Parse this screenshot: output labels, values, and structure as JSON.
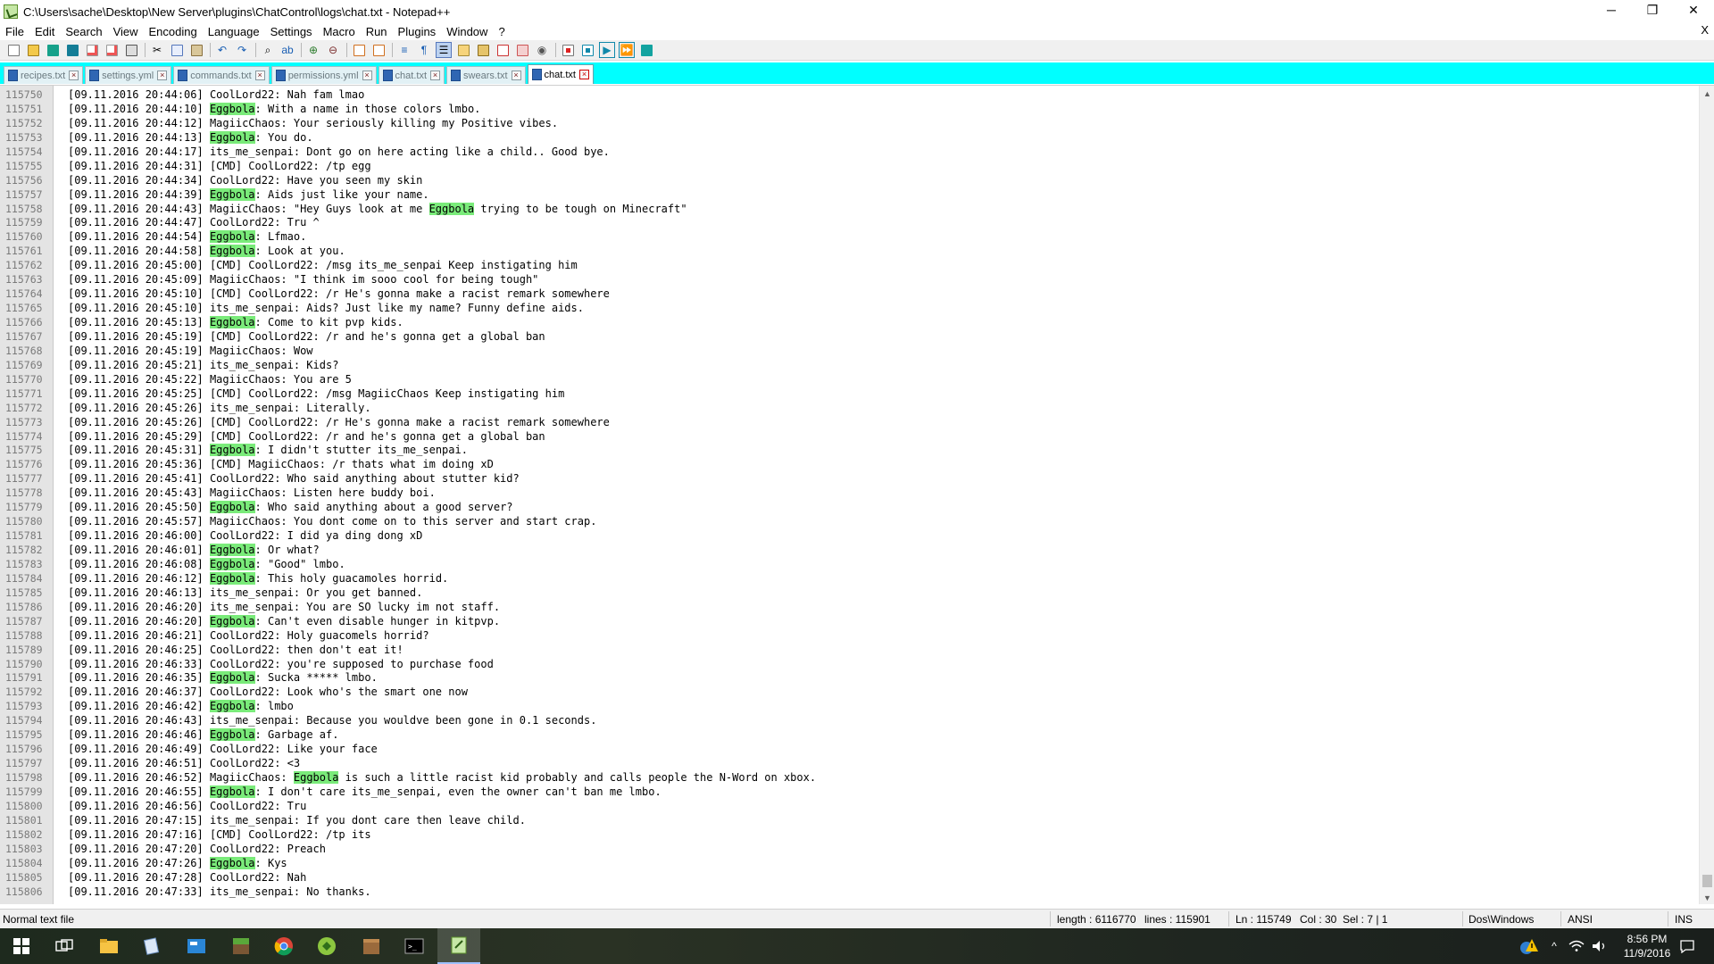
{
  "window": {
    "title": "C:\\Users\\sache\\Desktop\\New Server\\plugins\\ChatControl\\logs\\chat.txt - Notepad++",
    "controls": {
      "minimize": "─",
      "restore": "❐",
      "close": "✕"
    }
  },
  "menu": {
    "items": [
      "File",
      "Edit",
      "Search",
      "View",
      "Encoding",
      "Language",
      "Settings",
      "Macro",
      "Run",
      "Plugins",
      "Window",
      "?"
    ],
    "close_glyph": "X"
  },
  "toolbar": {
    "buttons": [
      "new-file",
      "open-file",
      "save",
      "save-all",
      "close",
      "close-all",
      "print",
      "cut",
      "copy",
      "paste",
      "undo",
      "redo",
      "find",
      "replace",
      "zoom-in",
      "zoom-out",
      "sync-vertical",
      "sync-horizontal",
      "word-wrap",
      "show-all-chars",
      "indent-guide",
      "user-defined-language",
      "document-map",
      "function-list",
      "folder-as-workspace",
      "monitoring",
      "macro-record",
      "macro-stop",
      "macro-play",
      "macro-play-multiple",
      "macro-save"
    ]
  },
  "tabs": [
    {
      "label": "recipes.txt",
      "active": false
    },
    {
      "label": "settings.yml",
      "active": false
    },
    {
      "label": "commands.txt",
      "active": false
    },
    {
      "label": "permissions.yml",
      "active": false
    },
    {
      "label": "chat.txt",
      "active": false
    },
    {
      "label": "swears.txt",
      "active": false
    },
    {
      "label": "chat.txt",
      "active": true
    }
  ],
  "editor": {
    "highlight_word": "Eggbola",
    "highlight_color": "#7aeb7a",
    "lines": [
      {
        "n": "115750",
        "text": "[09.11.2016 20:44:06] CoolLord22: Nah fam lmao"
      },
      {
        "n": "115751",
        "text": "[09.11.2016 20:44:10] Eggbola: With a name in those colors lmbo."
      },
      {
        "n": "115752",
        "text": "[09.11.2016 20:44:12] MagiicChaos: Your seriously killing my Positive vibes."
      },
      {
        "n": "115753",
        "text": "[09.11.2016 20:44:13] Eggbola: You do."
      },
      {
        "n": "115754",
        "text": "[09.11.2016 20:44:17] its_me_senpai: Dont go on here acting like a child.. Good bye."
      },
      {
        "n": "115755",
        "text": "[09.11.2016 20:44:31] [CMD] CoolLord22: /tp egg"
      },
      {
        "n": "115756",
        "text": "[09.11.2016 20:44:34] CoolLord22: Have you seen my skin"
      },
      {
        "n": "115757",
        "text": "[09.11.2016 20:44:39] Eggbola: Aids just like your name."
      },
      {
        "n": "115758",
        "text": "[09.11.2016 20:44:43] MagiicChaos: \"Hey Guys look at me Eggbola trying to be tough on Minecraft\""
      },
      {
        "n": "115759",
        "text": "[09.11.2016 20:44:47] CoolLord22: Tru ^"
      },
      {
        "n": "115760",
        "text": "[09.11.2016 20:44:54] Eggbola: Lfmao."
      },
      {
        "n": "115761",
        "text": "[09.11.2016 20:44:58] Eggbola: Look at you."
      },
      {
        "n": "115762",
        "text": "[09.11.2016 20:45:00] [CMD] CoolLord22: /msg its_me_senpai Keep instigating him"
      },
      {
        "n": "115763",
        "text": "[09.11.2016 20:45:09] MagiicChaos: \"I think im sooo cool for being tough\""
      },
      {
        "n": "115764",
        "text": "[09.11.2016 20:45:10] [CMD] CoolLord22: /r He's gonna make a racist remark somewhere"
      },
      {
        "n": "115765",
        "text": "[09.11.2016 20:45:10] its_me_senpai: Aids? Just like my name? Funny define aids."
      },
      {
        "n": "115766",
        "text": "[09.11.2016 20:45:13] Eggbola: Come to kit pvp kids."
      },
      {
        "n": "115767",
        "text": "[09.11.2016 20:45:19] [CMD] CoolLord22: /r and he's gonna get a global ban"
      },
      {
        "n": "115768",
        "text": "[09.11.2016 20:45:19] MagiicChaos: Wow"
      },
      {
        "n": "115769",
        "text": "[09.11.2016 20:45:21] its_me_senpai: Kids?"
      },
      {
        "n": "115770",
        "text": "[09.11.2016 20:45:22] MagiicChaos: You are 5"
      },
      {
        "n": "115771",
        "text": "[09.11.2016 20:45:25] [CMD] CoolLord22: /msg MagiicChaos Keep instigating him"
      },
      {
        "n": "115772",
        "text": "[09.11.2016 20:45:26] its_me_senpai: Literally."
      },
      {
        "n": "115773",
        "text": "[09.11.2016 20:45:26] [CMD] CoolLord22: /r He's gonna make a racist remark somewhere"
      },
      {
        "n": "115774",
        "text": "[09.11.2016 20:45:29] [CMD] CoolLord22: /r and he's gonna get a global ban"
      },
      {
        "n": "115775",
        "text": "[09.11.2016 20:45:31] Eggbola: I didn't stutter its_me_senpai."
      },
      {
        "n": "115776",
        "text": "[09.11.2016 20:45:36] [CMD] MagiicChaos: /r thats what im doing xD"
      },
      {
        "n": "115777",
        "text": "[09.11.2016 20:45:41] CoolLord22: Who said anything about stutter kid?"
      },
      {
        "n": "115778",
        "text": "[09.11.2016 20:45:43] MagiicChaos: Listen here buddy boi."
      },
      {
        "n": "115779",
        "text": "[09.11.2016 20:45:50] Eggbola: Who said anything about a good server?"
      },
      {
        "n": "115780",
        "text": "[09.11.2016 20:45:57] MagiicChaos: You dont come on to this server and start crap."
      },
      {
        "n": "115781",
        "text": "[09.11.2016 20:46:00] CoolLord22: I did ya ding dong xD"
      },
      {
        "n": "115782",
        "text": "[09.11.2016 20:46:01] Eggbola: Or what?"
      },
      {
        "n": "115783",
        "text": "[09.11.2016 20:46:08] Eggbola: \"Good\" lmbo."
      },
      {
        "n": "115784",
        "text": "[09.11.2016 20:46:12] Eggbola: This holy guacamoles horrid."
      },
      {
        "n": "115785",
        "text": "[09.11.2016 20:46:13] its_me_senpai: Or you get banned."
      },
      {
        "n": "115786",
        "text": "[09.11.2016 20:46:20] its_me_senpai: You are SO lucky im not staff."
      },
      {
        "n": "115787",
        "text": "[09.11.2016 20:46:20] Eggbola: Can't even disable hunger in kitpvp."
      },
      {
        "n": "115788",
        "text": "[09.11.2016 20:46:21] CoolLord22: Holy guacomels horrid?"
      },
      {
        "n": "115789",
        "text": "[09.11.2016 20:46:25] CoolLord22: then don't eat it!"
      },
      {
        "n": "115790",
        "text": "[09.11.2016 20:46:33] CoolLord22: you're supposed to purchase food"
      },
      {
        "n": "115791",
        "text": "[09.11.2016 20:46:35] Eggbola: Sucka ***** lmbo."
      },
      {
        "n": "115792",
        "text": "[09.11.2016 20:46:37] CoolLord22: Look who's the smart one now"
      },
      {
        "n": "115793",
        "text": "[09.11.2016 20:46:42] Eggbola: lmbo"
      },
      {
        "n": "115794",
        "text": "[09.11.2016 20:46:43] its_me_senpai: Because you wouldve been gone in 0.1 seconds."
      },
      {
        "n": "115795",
        "text": "[09.11.2016 20:46:46] Eggbola: Garbage af."
      },
      {
        "n": "115796",
        "text": "[09.11.2016 20:46:49] CoolLord22: Like your face"
      },
      {
        "n": "115797",
        "text": "[09.11.2016 20:46:51] CoolLord22: <3"
      },
      {
        "n": "115798",
        "text": "[09.11.2016 20:46:52] MagiicChaos: Eggbola is such a little racist kid probably and calls people the N-Word on xbox."
      },
      {
        "n": "115799",
        "text": "[09.11.2016 20:46:55] Eggbola: I don't care its_me_senpai, even the owner can't ban me lmbo."
      },
      {
        "n": "115800",
        "text": "[09.11.2016 20:46:56] CoolLord22: Tru"
      },
      {
        "n": "115801",
        "text": "[09.11.2016 20:47:15] its_me_senpai: If you dont care then leave child."
      },
      {
        "n": "115802",
        "text": "[09.11.2016 20:47:16] [CMD] CoolLord22: /tp its"
      },
      {
        "n": "115803",
        "text": "[09.11.2016 20:47:20] CoolLord22: Preach"
      },
      {
        "n": "115804",
        "text": "[09.11.2016 20:47:26] Eggbola: Kys"
      },
      {
        "n": "115805",
        "text": "[09.11.2016 20:47:28] CoolLord22: Nah"
      },
      {
        "n": "115806",
        "text": "[09.11.2016 20:47:33] its_me_senpai: No thanks."
      }
    ]
  },
  "status": {
    "file_type": "Normal text file",
    "length": "length : 6116770",
    "lines": "lines : 115901",
    "ln": "Ln : 115749",
    "col": "Col : 30",
    "sel": "Sel : 7 | 1",
    "eol": "Dos\\Windows",
    "encoding": "ANSI",
    "mode": "INS"
  },
  "taskbar": {
    "apps": [
      "start",
      "task-view",
      "file-explorer",
      "notepad",
      "calculator",
      "minecraft",
      "chrome",
      "minecraft-launcher",
      "minecraft-server",
      "command-prompt",
      "notepad-plus-plus"
    ],
    "clock_time": "8:56 PM",
    "clock_date": "11/9/2016"
  }
}
